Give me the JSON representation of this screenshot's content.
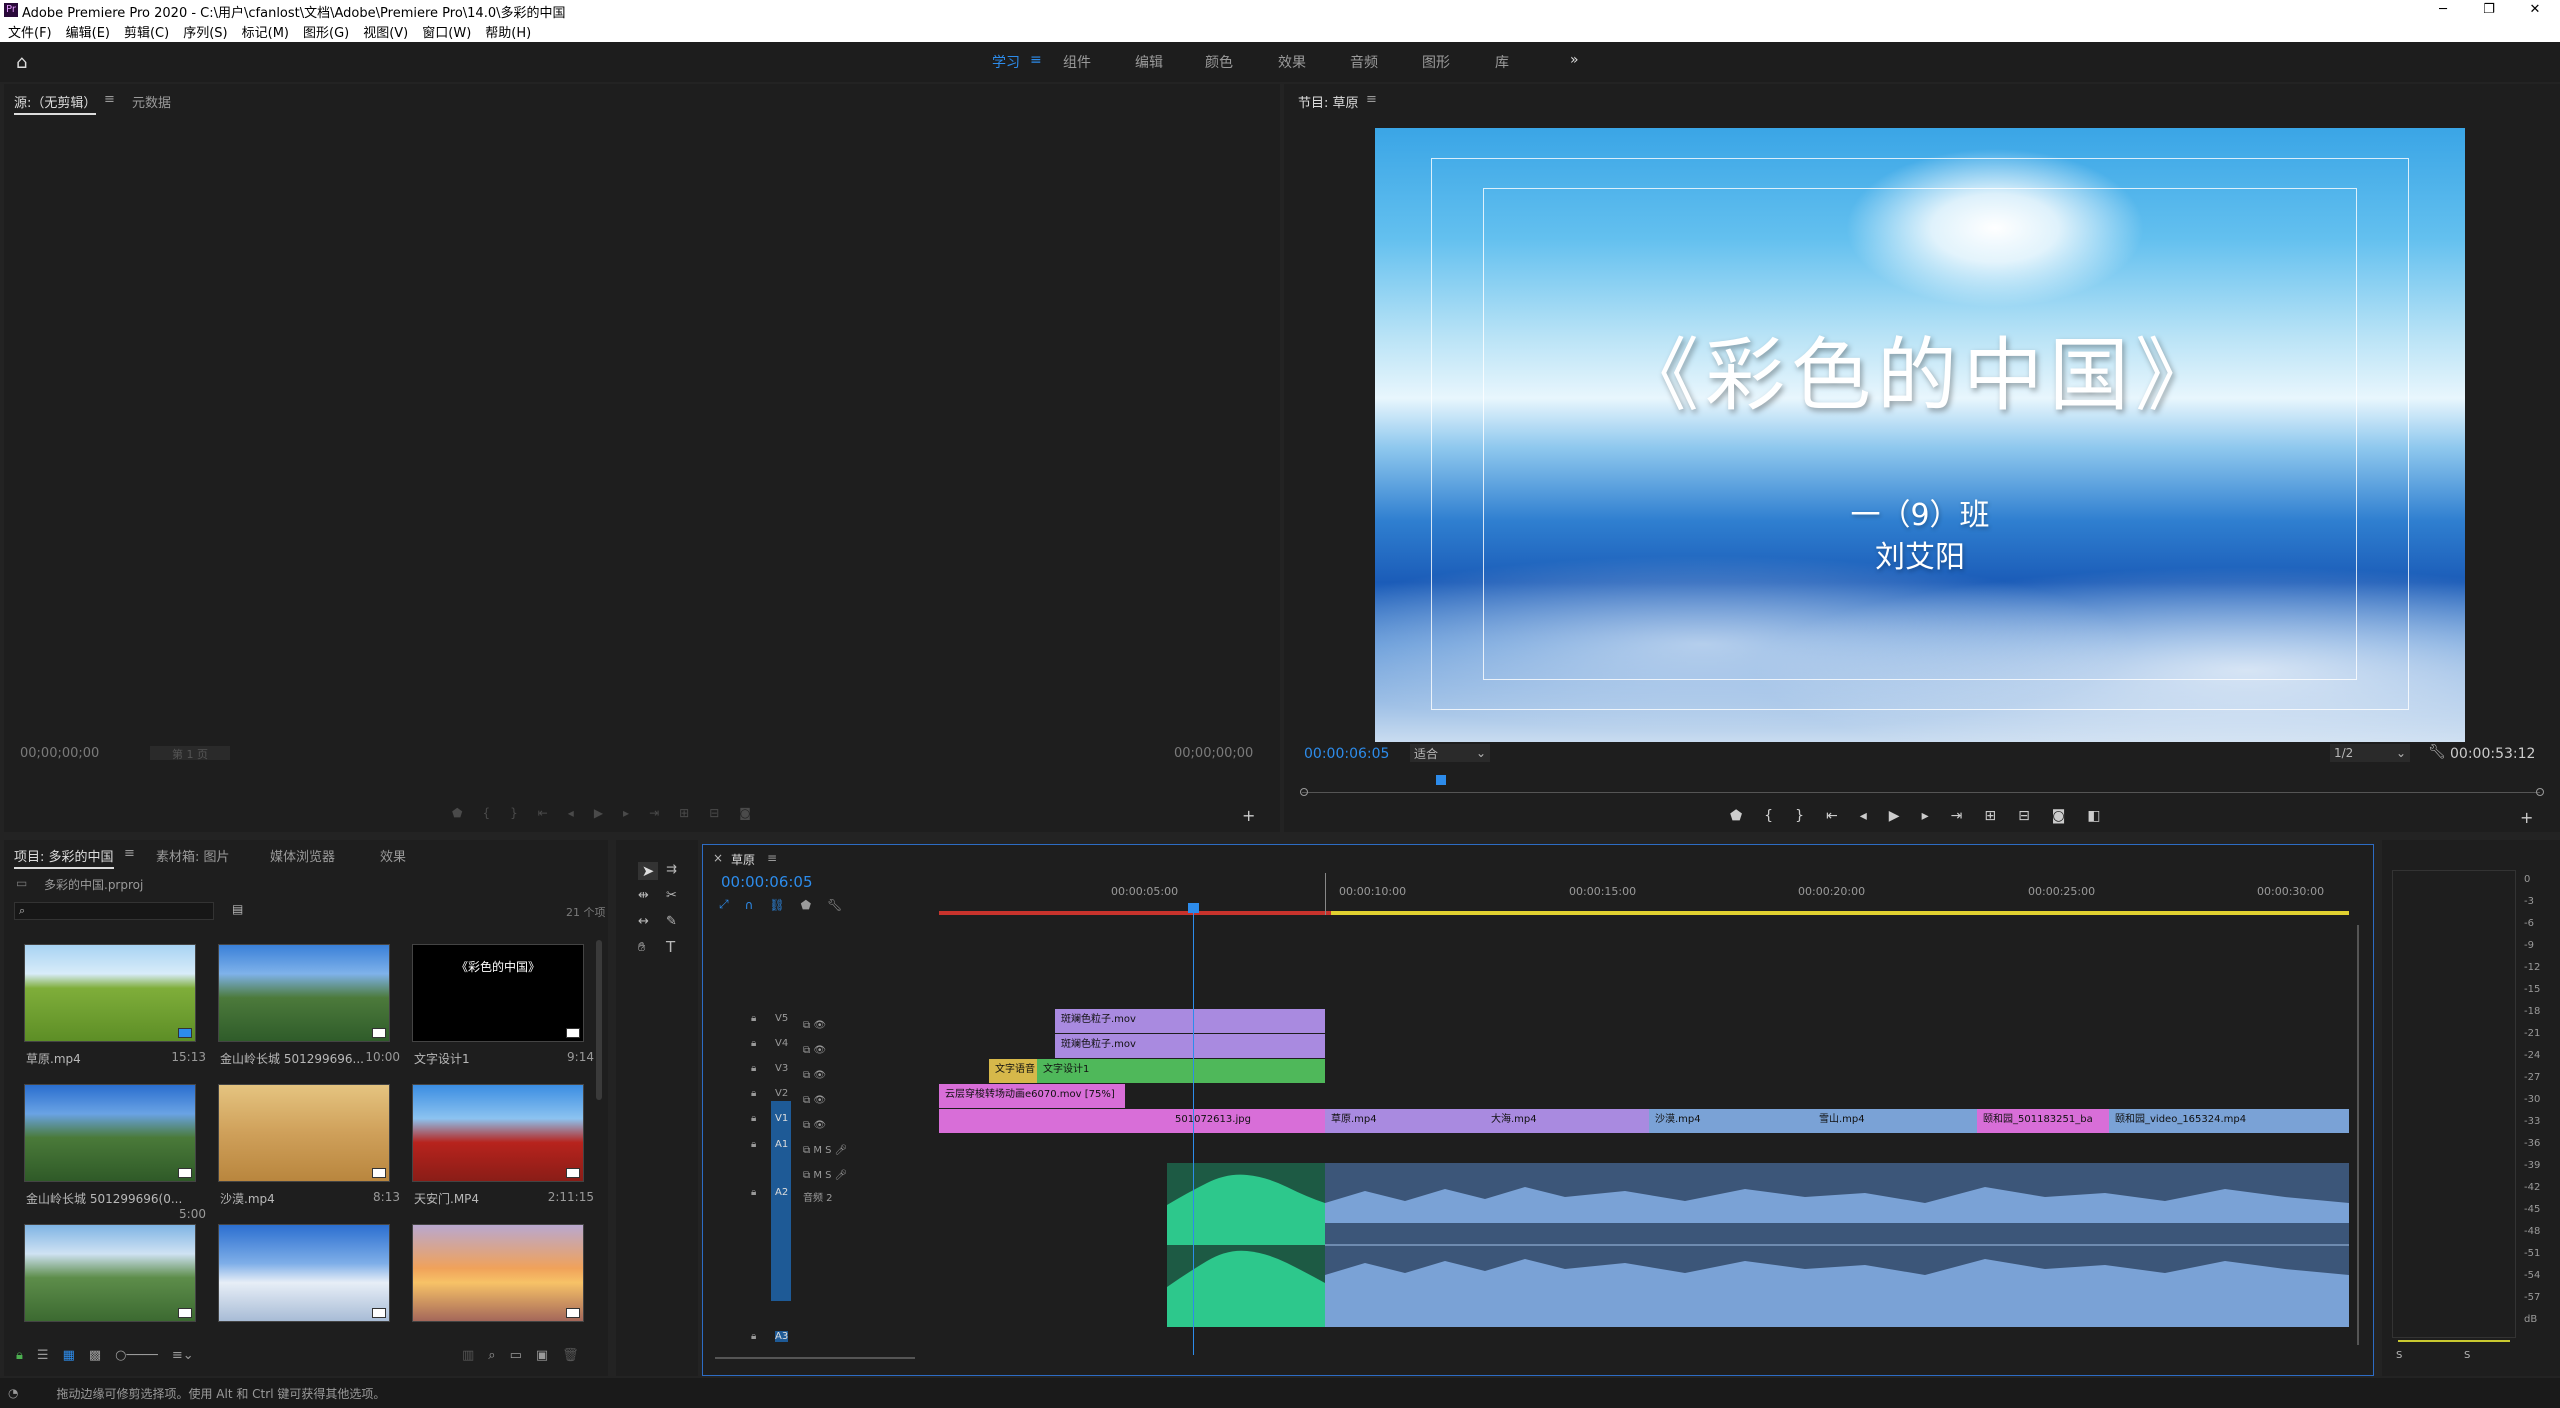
{
  "app": {
    "title": "Adobe Premiere Pro 2020 - C:\\用户\\cfanlost\\文档\\Adobe\\Premiere Pro\\14.0\\多彩的中国"
  },
  "window": {
    "min": "─",
    "max": "❐",
    "close": "✕"
  },
  "menu": [
    "文件(F)",
    "编辑(E)",
    "剪辑(C)",
    "序列(S)",
    "标记(M)",
    "图形(G)",
    "视图(V)",
    "窗口(W)",
    "帮助(H)"
  ],
  "workspaces": {
    "items": [
      "学习",
      "组件",
      "编辑",
      "颜色",
      "效果",
      "音频",
      "图形",
      "库"
    ],
    "active": "学习",
    "menu_icon": "≡",
    "more": "»"
  },
  "source": {
    "tab": "源:（无剪辑）",
    "tab2": "元数据",
    "tc_left": "00;00;00;00",
    "tc_right": "00;00;00;00",
    "page": "第 1 页"
  },
  "program": {
    "tab": "节目: 草原",
    "timecode": "00:00:06:05",
    "fit": "适合",
    "resolution": "1/2",
    "duration": "00:00:53:12",
    "title": "《彩色的中国》",
    "sub1": "一（9）班",
    "sub2": "刘艾阳"
  },
  "project": {
    "tabs": [
      "项目: 多彩的中国",
      "素材箱: 图片",
      "媒体浏览器",
      "效果"
    ],
    "file": "多彩的中国.prproj",
    "count": "21 个项",
    "items": [
      {
        "name": "草原.mp4",
        "dur": "15:13"
      },
      {
        "name": "金山岭长城 501299696...",
        "dur": "10:00"
      },
      {
        "name": "文字设计1",
        "dur": "9:14",
        "thumb_text": "《彩色的中国》"
      },
      {
        "name": "金山岭长城 501299696(0...",
        "dur": "5:00"
      },
      {
        "name": "沙漠.mp4",
        "dur": "8:13"
      },
      {
        "name": "天安门.MP4",
        "dur": "2:11:15"
      },
      {
        "name": "",
        "dur": ""
      },
      {
        "name": "",
        "dur": ""
      },
      {
        "name": "",
        "dur": ""
      }
    ]
  },
  "timeline": {
    "tab": "草原",
    "timecode": "00:00:06:05",
    "ruler": [
      "00:00:05:00",
      "00:00:10:00",
      "00:00:15:00",
      "00:00:20:00",
      "00:00:25:00",
      "00:00:30:00"
    ],
    "tracks": [
      "V5",
      "V4",
      "V3",
      "V2",
      "V1",
      "A1",
      "A2",
      "A3"
    ],
    "a2_label": "音频 2",
    "clips": {
      "v5": "斑斓色粒子.mov",
      "v4": "斑斓色粒子.mov",
      "v3a": "文字语音",
      "v3b": "文字设计1",
      "v2": "云层穿梭转场动画e6070.mov [75%]",
      "v1": [
        "501072613.jpg",
        "草原.mp4",
        "大海.mp4",
        "沙漠.mp4",
        "雪山.mp4",
        "颐和园_501183251_ba",
        "颐和园_video_165324.mp4"
      ]
    }
  },
  "meter": {
    "ticks": [
      "0",
      "-3",
      "-6",
      "-9",
      "-12",
      "-15",
      "-18",
      "-21",
      "-24",
      "-27",
      "-30",
      "-33",
      "-36",
      "-39",
      "-42",
      "-45",
      "-48",
      "-51",
      "-54",
      "-57",
      "dB"
    ],
    "s_left": "S",
    "s_right": "S"
  },
  "status": {
    "text": "拖动边缘可修剪选择项。使用 Alt 和 Ctrl 键可获得其他选项。"
  },
  "colors": {
    "accent": "#2d8ceb",
    "video_clip": "#d86ed8",
    "title_clip": "#4fb85a",
    "overlay_clip": "#a98ae0",
    "audio_clip": "#7aa2d6",
    "audio_green": "#2dc88c"
  }
}
